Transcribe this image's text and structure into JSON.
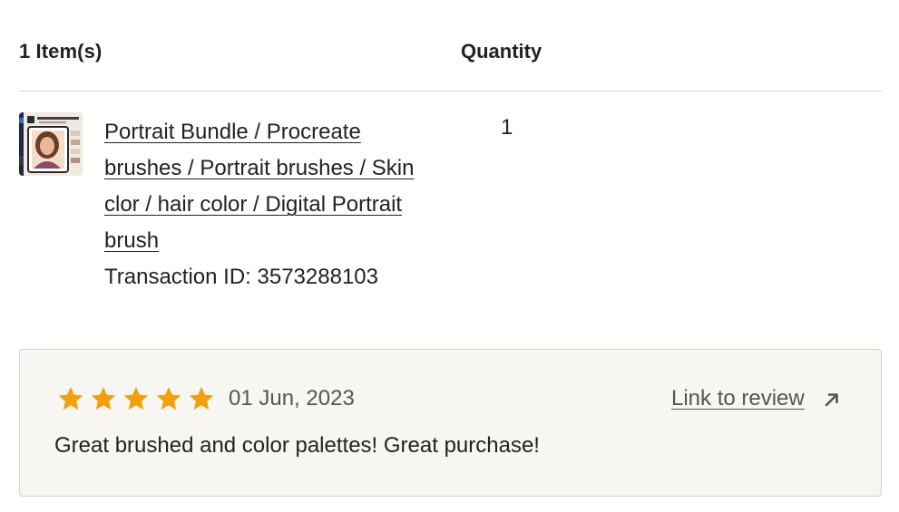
{
  "header": {
    "items_label": "1 Item(s)",
    "quantity_label": "Quantity"
  },
  "item": {
    "title": "Portrait Bundle / Procreate brushes / Portrait brushes / Skin clor / hair color / Digital Portrait brush",
    "transaction": "Transaction ID: 3573288103",
    "quantity": "1",
    "thumbnail_icon": "product-thumbnail"
  },
  "review": {
    "rating": 5,
    "max_rating": 5,
    "star_color": "#f1a10d",
    "date": "01 Jun, 2023",
    "link_label": "Link to review",
    "link_icon": "arrow-up-right-icon",
    "text": "Great brushed and color palettes! Great purchase!"
  }
}
